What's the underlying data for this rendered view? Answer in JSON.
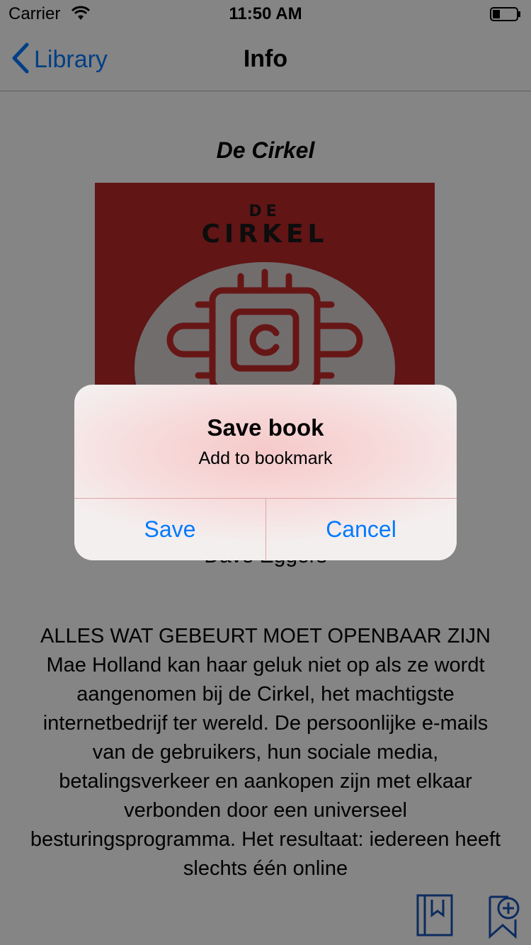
{
  "status_bar": {
    "carrier": "Carrier",
    "time": "11:50 AM"
  },
  "nav": {
    "back_label": "Library",
    "title": "Info"
  },
  "book": {
    "title": "De Cirkel",
    "cover_line1": "DE",
    "cover_line2": "CIRKEL",
    "author": "Dave Eggers",
    "description": "ALLES WAT GEBEURT MOET OPENBAAR ZIJN Mae Holland kan haar geluk niet op als ze wordt aangenomen bij de Cirkel, het machtigste internetbedrijf ter wereld. De persoonlijke e-mails van de gebruikers, hun sociale media, betalingsverkeer en aankopen zijn met elkaar verbonden door een universeel besturingsprogramma. Het resultaat: iedereen heeft slechts één online"
  },
  "toolbar": {
    "icons": [
      "book-bookmark-icon",
      "add-bookmark-icon"
    ]
  },
  "alert": {
    "title": "Save book",
    "message": "Add to bookmark",
    "save_label": "Save",
    "cancel_label": "Cancel"
  },
  "colors": {
    "tint": "#007aff",
    "cover_red": "#ba2929",
    "overlay": "rgba(0,0,0,0.48)"
  }
}
